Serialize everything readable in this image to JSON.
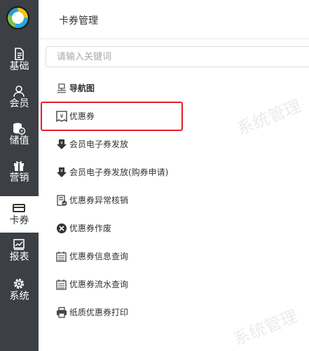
{
  "nav": {
    "items": [
      {
        "label": "基础",
        "icon": "document-icon"
      },
      {
        "label": "会员",
        "icon": "user-icon"
      },
      {
        "label": "储值",
        "icon": "coin-stack-icon"
      },
      {
        "label": "营销",
        "icon": "gift-icon"
      },
      {
        "label": "卡券",
        "icon": "card-icon",
        "active": true
      },
      {
        "label": "报表",
        "icon": "chart-icon"
      },
      {
        "label": "系统",
        "icon": "gear-icon"
      }
    ]
  },
  "panel": {
    "title": "卡券管理",
    "search_placeholder": "请输入关键词",
    "menu": [
      {
        "label": "导航图",
        "icon": "navigation-map-icon",
        "header": true
      },
      {
        "label": "优惠券",
        "icon": "coupon-yen-icon",
        "highlighted": true
      },
      {
        "label": "会员电子券发放",
        "icon": "download-coupon-icon"
      },
      {
        "label": "会员电子券发放(购券申请)",
        "icon": "download-coupon-icon"
      },
      {
        "label": "优惠券异常核销",
        "icon": "document-check-icon"
      },
      {
        "label": "优惠券作废",
        "icon": "close-circle-icon"
      },
      {
        "label": "优惠券信息查询",
        "icon": "calendar-list-icon"
      },
      {
        "label": "优惠券流水查询",
        "icon": "calendar-list-icon"
      },
      {
        "label": "纸质优惠券打印",
        "icon": "printer-icon"
      }
    ]
  },
  "watermark": "系统管理"
}
